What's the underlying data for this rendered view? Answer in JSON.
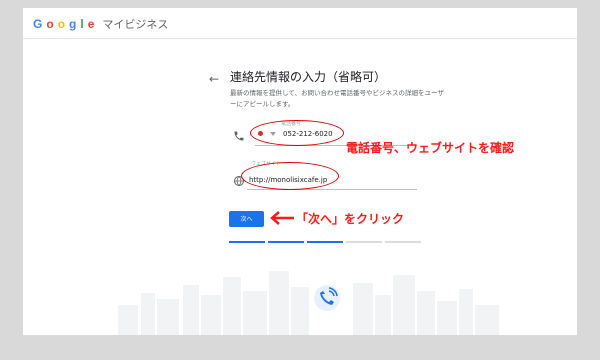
{
  "app": {
    "brand_letters": [
      "G",
      "o",
      "o",
      "g",
      "l",
      "e"
    ],
    "product": "マイビジネス"
  },
  "form": {
    "back_icon": "arrow-left-icon",
    "title": "連絡先情報の入力（省略可）",
    "description": "最新の情報を提供して、お問い合わせ電話番号やビジネスの詳細をユーザーにアピールします。",
    "phone": {
      "label": "電話番号",
      "icon": "phone-icon",
      "value": "052-212-6020"
    },
    "website": {
      "label": "ウェブサイト",
      "icon": "globe-icon",
      "value": "http://monolisixcafe.jp"
    },
    "next_label": "次へ",
    "progress": {
      "total": 5,
      "completed": 3
    }
  },
  "annotations": {
    "confirm_text": "電話番号、ウェブサイトを確認",
    "click_text": "「次へ」をクリック",
    "color": "#ff1a1a"
  },
  "colors": {
    "accent": "#1a73e8",
    "annotation": "#ff1a1a"
  }
}
